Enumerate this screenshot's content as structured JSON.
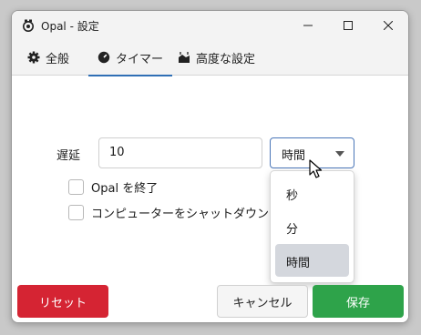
{
  "window": {
    "title": "Opal - 設定"
  },
  "tabs": [
    {
      "label": "全般",
      "icon": "gear-icon"
    },
    {
      "label": "タイマー",
      "icon": "timer-icon"
    },
    {
      "label": "高度な設定",
      "icon": "advanced-icon"
    }
  ],
  "active_tab": "タイマー",
  "delay": {
    "label": "遅延",
    "value": "10",
    "unit_selected": "時間"
  },
  "unit_options": [
    "秒",
    "分",
    "時間"
  ],
  "checkboxes": [
    {
      "label": "Opal を終了",
      "checked": false
    },
    {
      "label": "コンピューターをシャットダウン",
      "checked": false
    }
  ],
  "buttons": {
    "reset": "リセット",
    "cancel": "キャンセル",
    "save": "保存"
  },
  "colors": {
    "accent": "#2f6fb5",
    "reset": "#d52433",
    "save": "#2ea34a"
  }
}
